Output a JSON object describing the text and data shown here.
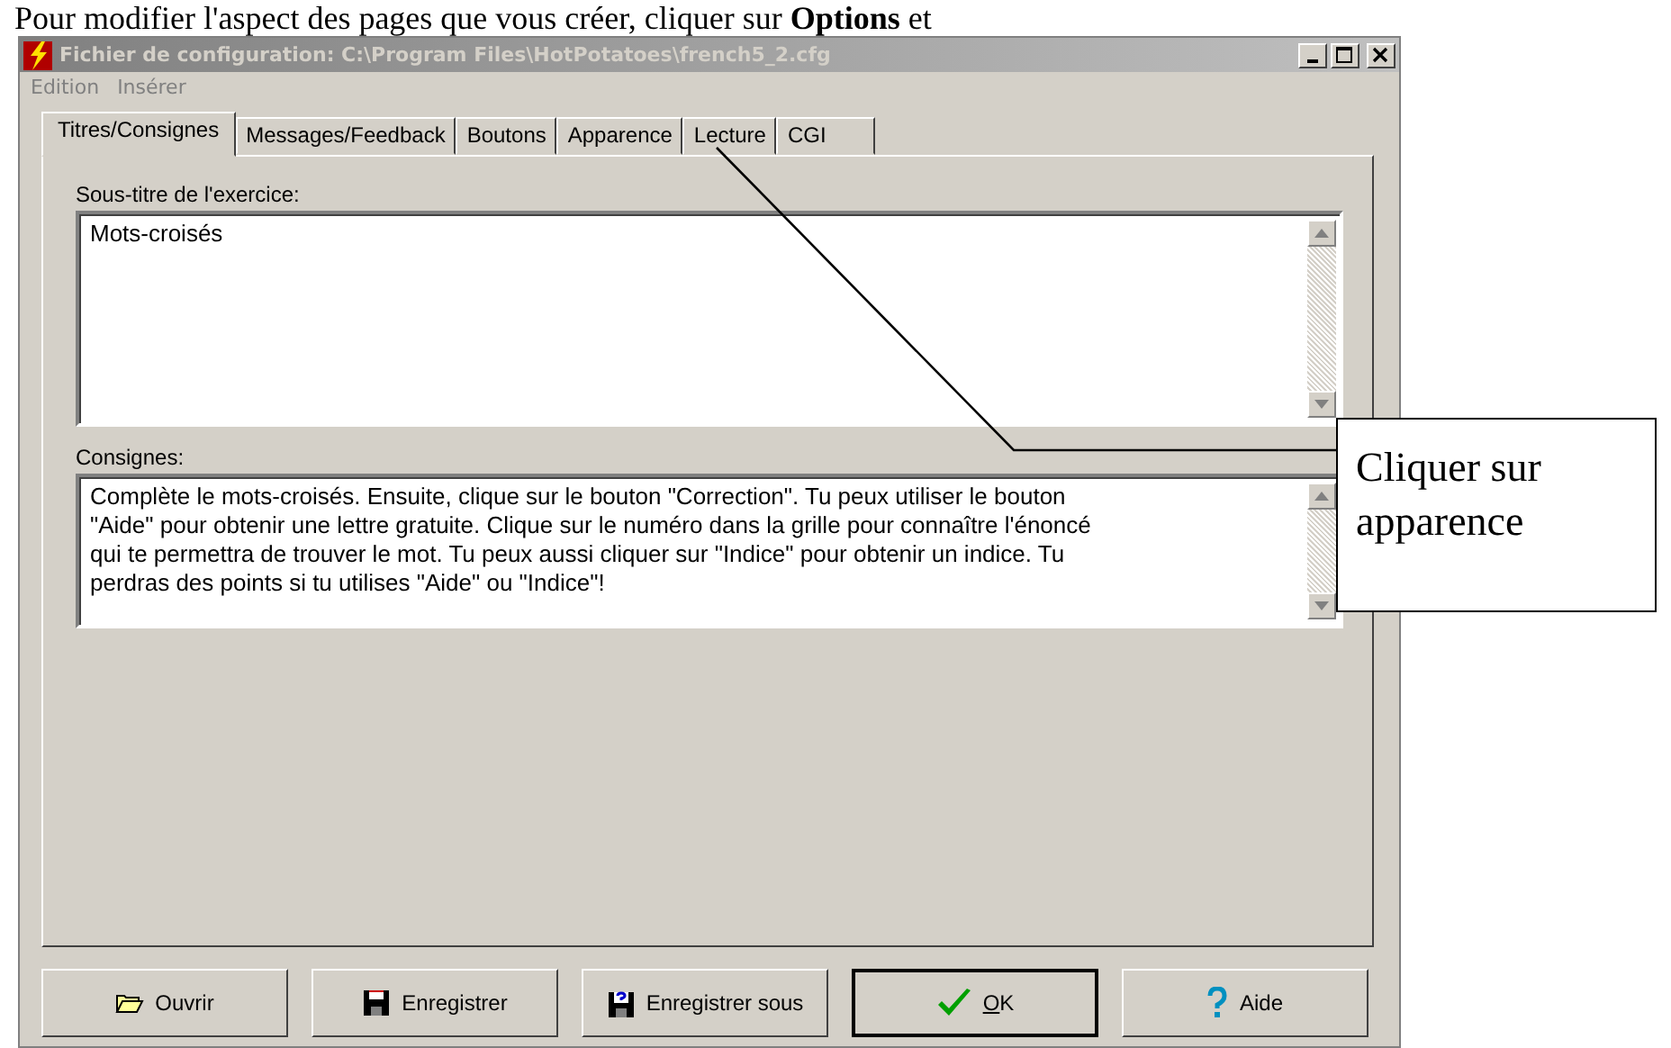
{
  "page_text": "Pour modifier l'aspect des pages que vous créer, cliquer sur **Options** et",
  "window": {
    "title": "Fichier de configuration: C:\\Program Files\\HotPotatoes\\french5_2.cfg"
  },
  "menu": [
    "Edition",
    "Insérer"
  ],
  "tabs": [
    {
      "label": "Titres/Consignes",
      "selected": true
    },
    {
      "label": "Messages/Feedback",
      "selected": false
    },
    {
      "label": "Boutons",
      "selected": false
    },
    {
      "label": "Apparence",
      "selected": false
    },
    {
      "label": "Lecture",
      "selected": false
    },
    {
      "label": "CGI",
      "selected": false
    }
  ],
  "fields": [
    {
      "label": "Sous-titre de l'exercice:",
      "value": "Mots-croisés",
      "kind": "tall"
    },
    {
      "label": "Consignes:",
      "value": "Complète le mots-croisés. Ensuite, clique sur le bouton \"Correction\".  Tu peux utiliser le bouton \"Aide\" pour obtenir une lettre gratuite. Clique sur le numéro dans la grille pour connaître l'énoncé qui te permettra de trouver le mot. Tu peux aussi cliquer sur  \"Indice\" pour obtenir un indice. Tu perdras des points si tu utilises \"Aide\" ou \"Indice\"!",
      "kind": "short"
    }
  ],
  "buttons": [
    {
      "label": "Ouvrir",
      "default": false,
      "underline_first": false
    },
    {
      "label": "Enregistrer",
      "default": false,
      "underline_first": false
    },
    {
      "label": "Enregistrer sous",
      "default": false,
      "underline_first": false
    },
    {
      "label": "OK",
      "default": true,
      "underline_first": true
    },
    {
      "label": "Aide",
      "default": false,
      "underline_first": false
    }
  ],
  "callout": {
    "text": "Cliquer sur apparence"
  }
}
